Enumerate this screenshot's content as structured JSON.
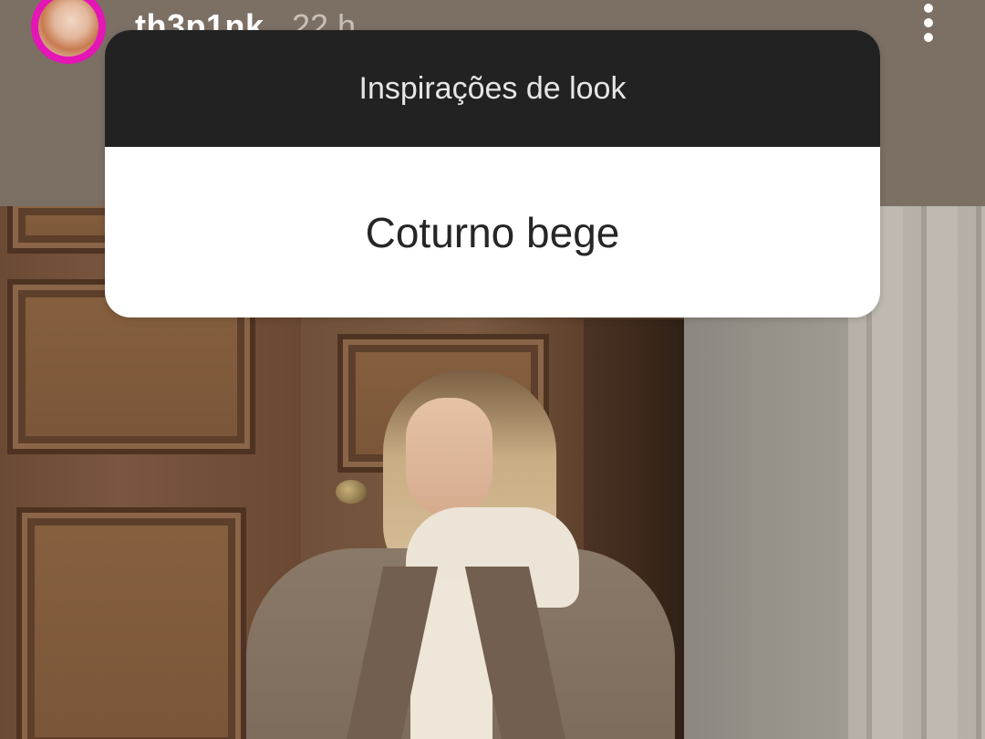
{
  "story": {
    "username": "th3p1nk",
    "timestamp": "22 h",
    "avatar_icon": "profile-avatar",
    "more_icon": "more-vertical-icon",
    "ring_color": "#e416b6"
  },
  "question_sticker": {
    "title": "Inspirações de look",
    "answer": "Coturno bege",
    "header_color": "#222222"
  }
}
